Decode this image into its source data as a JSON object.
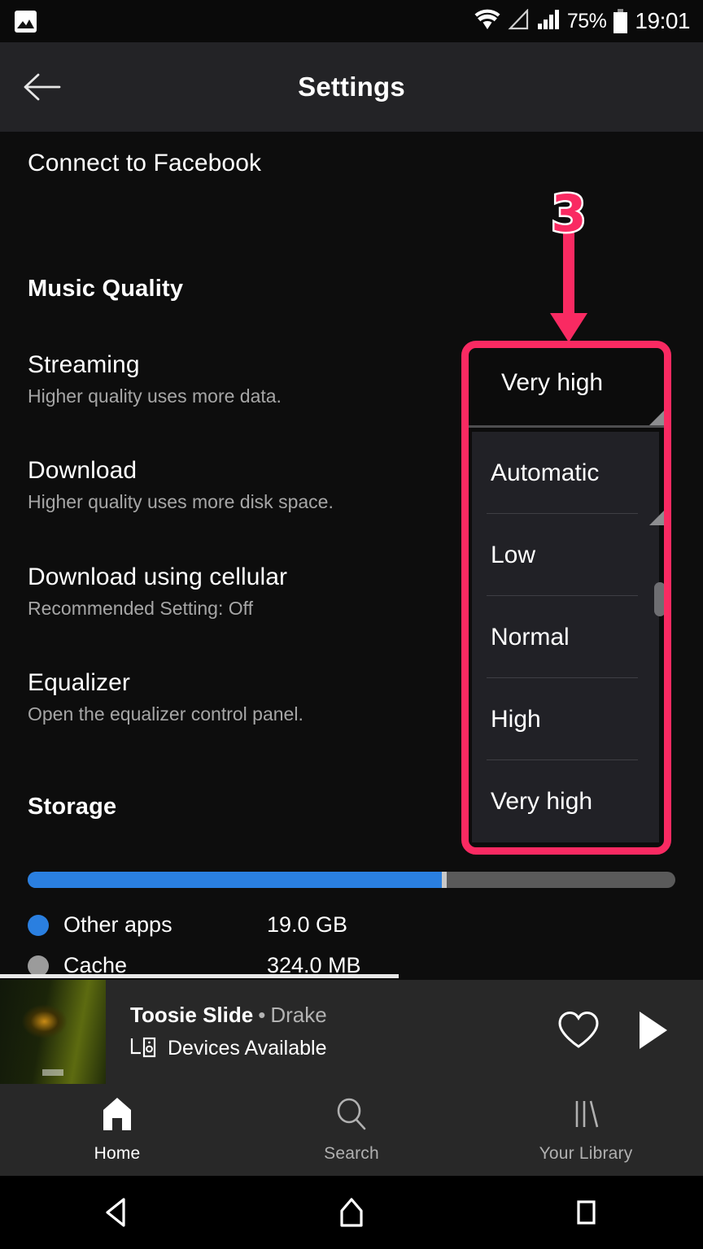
{
  "statusbar": {
    "notification_icon": "image-icon",
    "wifi_icon": "wifi-icon",
    "signal_alt_icon": "signal-triangle-icon",
    "signal_icon": "cellular-signal-icon",
    "battery_percent": "75%",
    "battery_icon": "battery-icon",
    "time": "19:01"
  },
  "appbar": {
    "back_icon": "back-arrow-icon",
    "title": "Settings"
  },
  "settings": {
    "facebook_row": {
      "title": "Connect to Facebook"
    },
    "music_quality_header": "Music Quality",
    "rows": [
      {
        "title": "Streaming",
        "subtitle": "Higher quality uses more data."
      },
      {
        "title": "Download",
        "subtitle": "Higher quality uses more disk space."
      },
      {
        "title": "Download using cellular",
        "subtitle": "Recommended Setting: Off"
      },
      {
        "title": "Equalizer",
        "subtitle": "Open the equalizer control panel."
      }
    ],
    "storage_header": "Storage",
    "storage": {
      "bar_fill_percent": 64,
      "legend": [
        {
          "label": "Other apps",
          "value": "19.0 GB",
          "color": "#2a7fe0"
        },
        {
          "label": "Cache",
          "value": "324.0 MB",
          "color": "#9b9b9b"
        }
      ]
    }
  },
  "dropdown": {
    "current_value": "Very high",
    "options": [
      "Automatic",
      "Low",
      "Normal",
      "High",
      "Very high"
    ],
    "highlight_color": "#f92a62"
  },
  "callout": {
    "number": "3",
    "color": "#f92a62",
    "arrow_icon": "down-arrow-icon"
  },
  "now_playing": {
    "album_art": "album-art-thumbnail",
    "track": "Toosie Slide",
    "separator": "•",
    "artist": "Drake",
    "devices_icon": "devices-icon",
    "devices_text": "Devices Available",
    "like_icon": "heart-icon",
    "play_icon": "play-icon"
  },
  "tabbar": {
    "tabs": [
      {
        "label": "Home",
        "icon": "home-icon",
        "active": true
      },
      {
        "label": "Search",
        "icon": "search-icon",
        "active": false
      },
      {
        "label": "Your Library",
        "icon": "library-icon",
        "active": false
      }
    ]
  },
  "sysnav": {
    "back": "system-back-icon",
    "home": "system-home-icon",
    "recents": "system-recents-icon"
  }
}
